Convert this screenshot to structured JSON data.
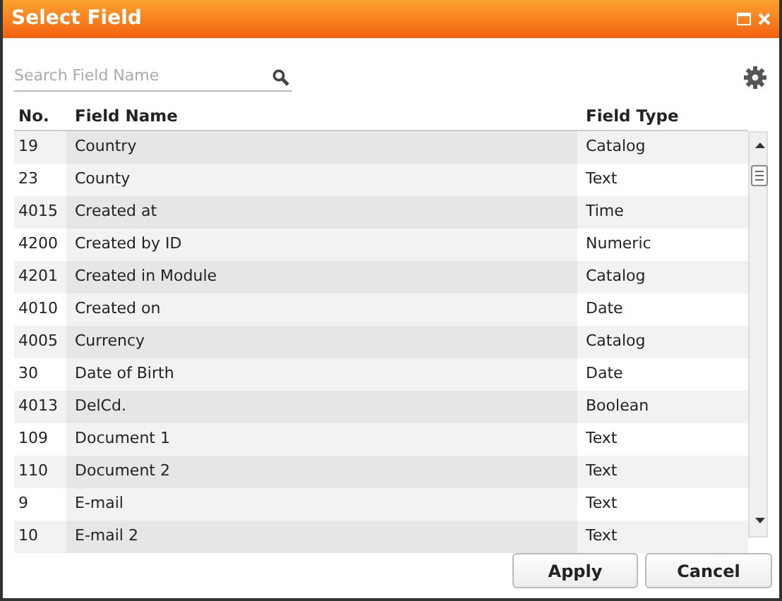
{
  "window": {
    "title": "Select Field"
  },
  "search": {
    "placeholder": "Search Field Name"
  },
  "table": {
    "columns": [
      "No.",
      "Field Name",
      "Field Type"
    ],
    "rows": [
      {
        "no": "19",
        "name": "Country",
        "type": "Catalog"
      },
      {
        "no": "23",
        "name": "County",
        "type": "Text"
      },
      {
        "no": "4015",
        "name": "Created at",
        "type": "Time"
      },
      {
        "no": "4200",
        "name": "Created by ID",
        "type": "Numeric"
      },
      {
        "no": "4201",
        "name": "Created in Module",
        "type": "Catalog"
      },
      {
        "no": "4010",
        "name": "Created on",
        "type": "Date"
      },
      {
        "no": "4005",
        "name": "Currency",
        "type": "Catalog"
      },
      {
        "no": "30",
        "name": "Date of Birth",
        "type": "Date"
      },
      {
        "no": "4013",
        "name": "DelCd.",
        "type": "Boolean"
      },
      {
        "no": "109",
        "name": "Document 1",
        "type": "Text"
      },
      {
        "no": "110",
        "name": "Document 2",
        "type": "Text"
      },
      {
        "no": "9",
        "name": "E-mail",
        "type": "Text"
      },
      {
        "no": "10",
        "name": "E-mail 2",
        "type": "Text"
      }
    ]
  },
  "buttons": [
    "Apply",
    "Cancel"
  ]
}
